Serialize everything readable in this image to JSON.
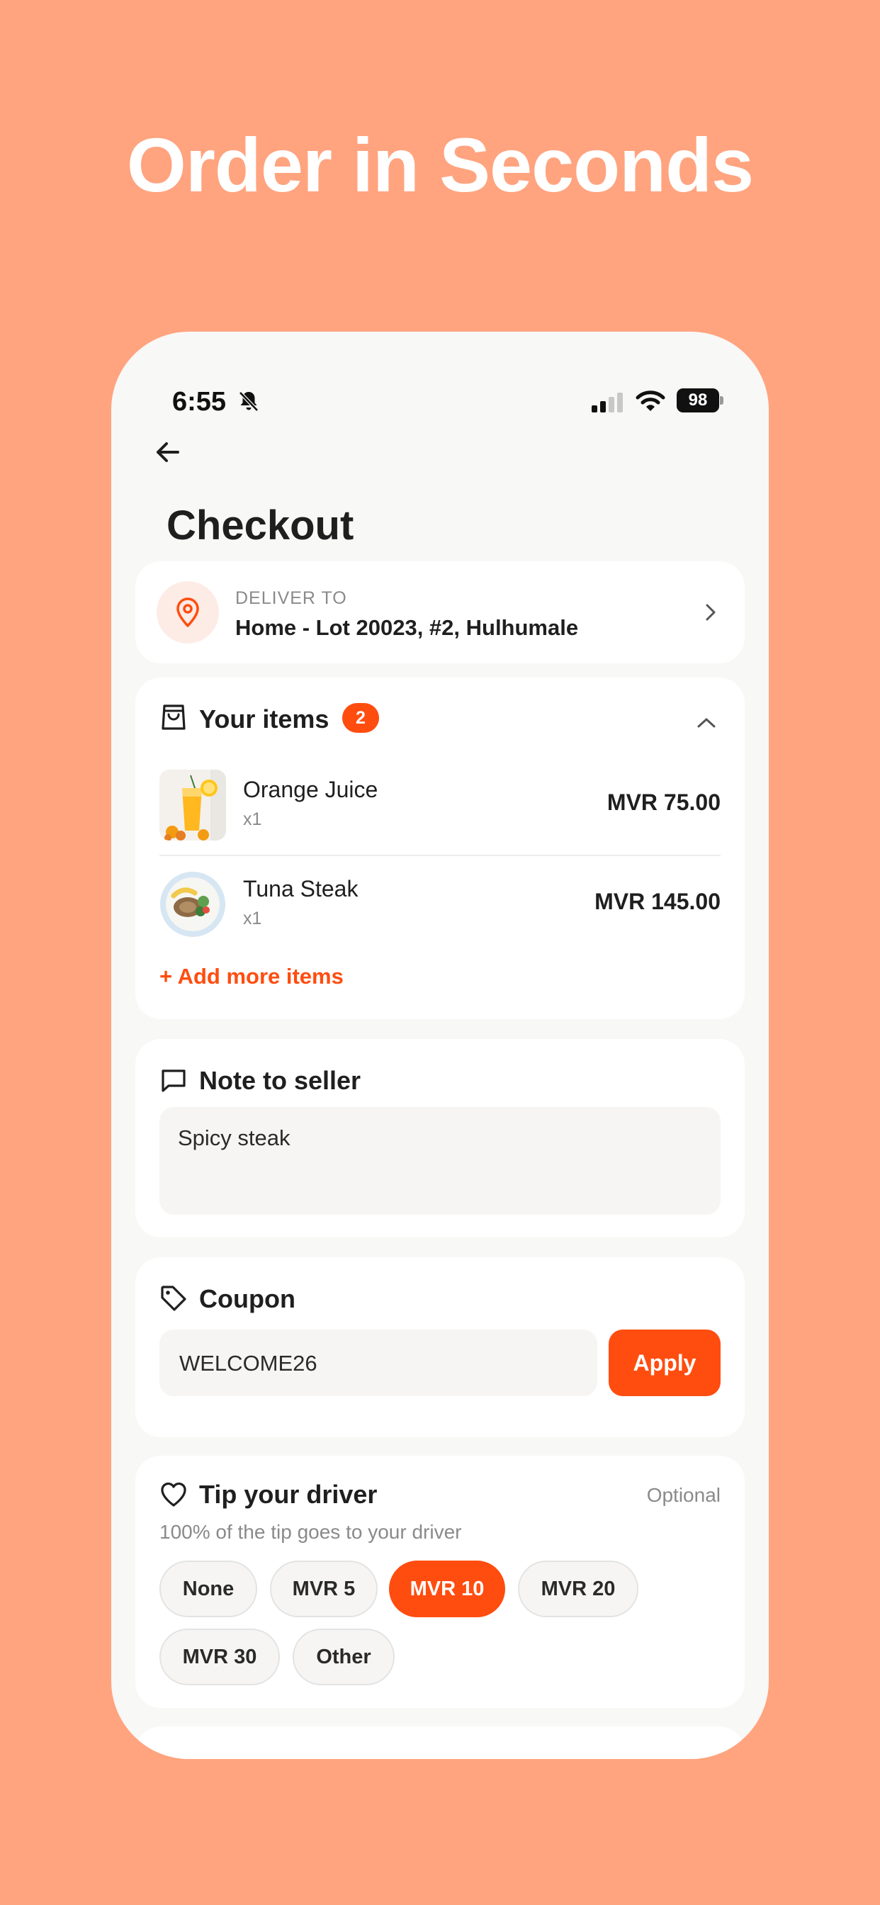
{
  "headline": "Order in Seconds",
  "status_bar": {
    "time": "6:55",
    "battery": "98",
    "icons": [
      "bell-slash-icon",
      "signal-icon",
      "wifi-icon",
      "battery-icon"
    ]
  },
  "page": {
    "title": "Checkout",
    "back_icon": "arrow-left-icon"
  },
  "delivery": {
    "label": "DELIVER TO",
    "address": "Home - Lot 20023, #2, Hulhumale",
    "icon": "map-pin-icon"
  },
  "items": {
    "title": "Your items",
    "count": "2",
    "list": [
      {
        "name": "Orange Juice",
        "qty": "x1",
        "price": "MVR 75.00"
      },
      {
        "name": "Tuna Steak",
        "qty": "x1",
        "price": "MVR 145.00"
      }
    ],
    "add_more": "+ Add more items"
  },
  "note": {
    "title": "Note to seller",
    "value": "Spicy steak"
  },
  "coupon": {
    "title": "Coupon",
    "value": "WELCOME26",
    "apply_label": "Apply"
  },
  "tip": {
    "title": "Tip your driver",
    "optional": "Optional",
    "subtitle": "100% of the tip goes to your driver",
    "options": [
      "None",
      "MVR 5",
      "MVR 10",
      "MVR 20",
      "MVR 30",
      "Other"
    ],
    "selected": "MVR 10"
  },
  "colors": {
    "background": "#FFA47F",
    "accent": "#FF4D0F",
    "card": "#FFFFFF",
    "screen": "#F8F8F6"
  }
}
